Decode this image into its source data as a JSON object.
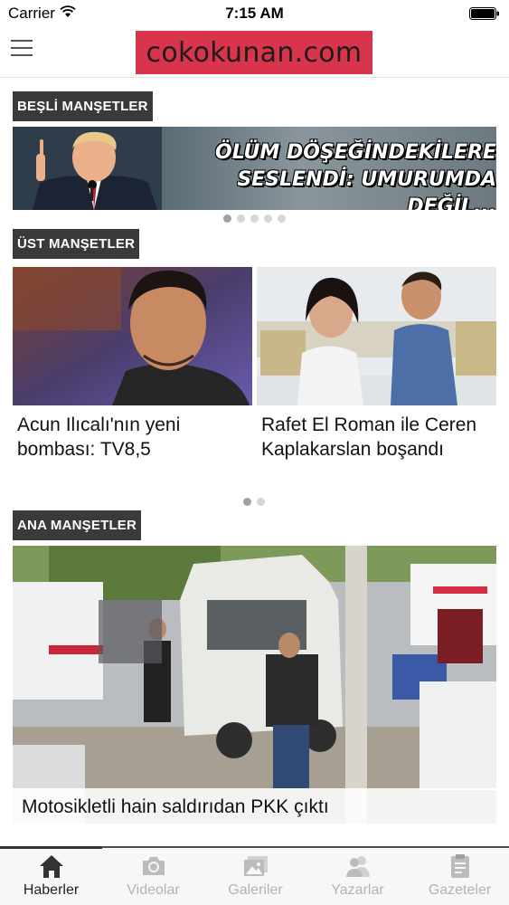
{
  "status_bar": {
    "carrier": "Carrier",
    "time": "7:15 AM"
  },
  "header": {
    "logo_text": "cokokunan.com",
    "menu_icon": "hamburger-menu-icon"
  },
  "sections": {
    "besli": {
      "label": "BEŞLİ MANŞETLER",
      "headline_line1": "ÖLÜM DÖŞEĞİNDEKİLERE",
      "headline_line2": "SESLENDİ: UMURUMDA DEĞİL...",
      "dot_count": 5,
      "active_dot": 0
    },
    "ust": {
      "label": "ÜST MANŞETLER",
      "cards": [
        {
          "title": "Acun Ilıcalı'nın yeni bombası: TV8,5"
        },
        {
          "title": "Rafet El Roman ile Ceren Kaplakarslan boşandı"
        }
      ],
      "dot_count": 2,
      "active_dot": 0
    },
    "ana": {
      "label": "ANA MANŞETLER",
      "caption": "Motosikletli hain saldırıdan PKK çıktı"
    }
  },
  "tabs": [
    {
      "label": "Haberler",
      "icon": "home-icon",
      "active": true
    },
    {
      "label": "Videolar",
      "icon": "camera-icon",
      "active": false
    },
    {
      "label": "Galeriler",
      "icon": "gallery-icon",
      "active": false
    },
    {
      "label": "Yazarlar",
      "icon": "users-icon",
      "active": false
    },
    {
      "label": "Gazeteler",
      "icon": "clipboard-icon",
      "active": false
    }
  ],
  "colors": {
    "logo_bg": "#d8344b",
    "section_label_bg": "#3a3a3a",
    "tab_active": "#222222",
    "tab_inactive": "#b3b3b3"
  }
}
